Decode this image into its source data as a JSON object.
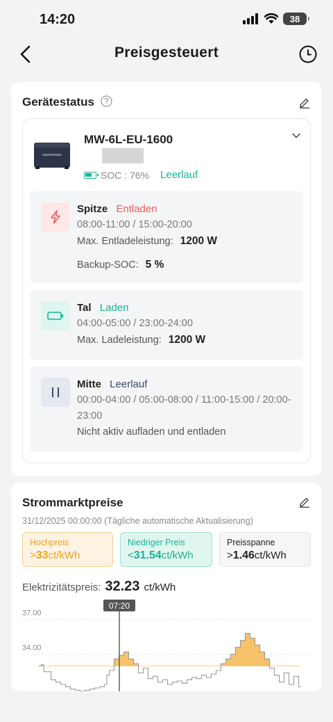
{
  "status_bar": {
    "time": "14:20",
    "battery": "38"
  },
  "nav": {
    "title": "Preisgesteuert"
  },
  "device_status": {
    "title": "Gerätestatus",
    "device_name": "MW-6L-EU-1600",
    "soc_text": "SOC : 76%",
    "state": "Leerlauf",
    "modes": [
      {
        "name": "Spitze",
        "action": "Entladen",
        "times": "08:00-11:00 / 15:00-20:00",
        "line1_label": "Max. Entladeleistung:",
        "line1_value": "1200 W",
        "line2_label": "Backup-SOC:",
        "line2_value": "5 %",
        "color": "#e85d5d"
      },
      {
        "name": "Tal",
        "action": "Laden",
        "times": "04:00-05:00 / 23:00-24:00",
        "line1_label": "Max. Ladeleistung:",
        "line1_value": "1200 W",
        "color": "#19b394"
      },
      {
        "name": "Mitte",
        "action": "Leerlauf",
        "times": "00:00-04:00 / 05:00-08:00 / 11:00-15:00 / 20:00-23:00",
        "note": "Nicht aktiv aufladen und entladen",
        "color": "#3a4a6b"
      }
    ]
  },
  "market": {
    "title": "Strommarktpreise",
    "update": "31/12/2025 00:00:00 (Tägliche automatische Aktualisierung)",
    "high": {
      "title": "Hochpreis",
      "prefix": ">",
      "value": "33",
      "unit": "ct/kWh",
      "color": "#f0a020"
    },
    "low": {
      "title": "Niedriger Preis",
      "prefix": "<",
      "value": "31.54",
      "unit": "ct/kWh",
      "color": "#19b394"
    },
    "span": {
      "title": "Preisspanne",
      "prefix": ">",
      "value": "1.46",
      "unit": "ct/kWh"
    },
    "elec_label": "Elektrizitätspreis:",
    "elec_value": "32.23",
    "elec_unit": "ct/kWh"
  },
  "chart_data": {
    "type": "line",
    "cursor_label": "07:20",
    "y_ticks": [
      "37.00",
      "34.00"
    ],
    "ylim": [
      30.8,
      38.0
    ],
    "threshold": 33,
    "values": [
      33.0,
      33.1,
      32.5,
      32.5,
      32.5,
      31.8,
      31.8,
      31.6,
      31.6,
      31.4,
      31.4,
      31.2,
      31.2,
      31.0,
      31.0,
      30.9,
      30.9,
      30.8,
      30.8,
      30.9,
      30.9,
      31.0,
      31.0,
      31.1,
      31.1,
      31.2,
      31.2,
      31.4,
      32.2,
      32.6,
      32.6,
      33.6,
      33.6,
      33.9,
      33.9,
      34.2,
      34.2,
      33.6,
      33.6,
      33.2,
      33.2,
      32.4,
      32.4,
      32.8,
      32.8,
      31.9,
      31.9,
      32.1,
      32.1,
      31.6,
      31.6,
      31.8,
      31.8,
      31.4,
      31.4,
      31.6,
      31.6,
      31.7,
      31.7,
      31.5,
      31.5,
      31.8,
      31.8,
      32.0,
      32.0,
      31.9,
      31.9,
      32.2,
      32.2,
      32.0,
      32.0,
      32.3,
      32.3,
      32.6,
      32.6,
      33.2,
      33.2,
      33.6,
      33.6,
      34.0,
      34.0,
      34.6,
      34.6,
      35.2,
      35.2,
      35.8,
      35.8,
      35.4,
      35.4,
      34.8,
      34.8,
      34.2,
      34.2,
      33.6,
      33.6,
      32.8,
      32.8,
      32.2,
      32.2,
      31.6,
      31.6,
      32.4,
      32.4,
      31.4,
      31.4,
      32.1,
      32.1,
      31.2
    ]
  }
}
